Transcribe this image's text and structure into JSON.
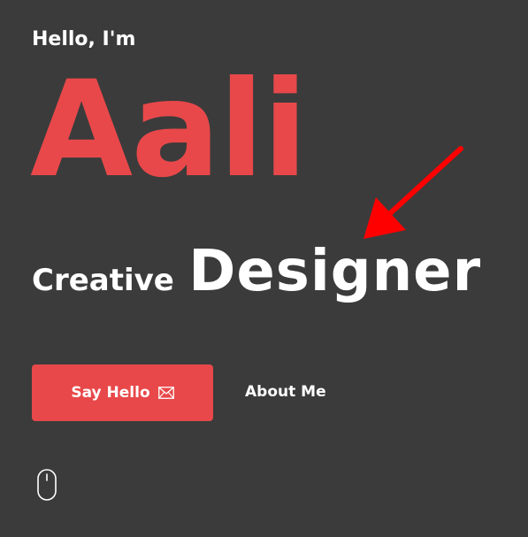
{
  "hero": {
    "greeting": "Hello, I'm",
    "name": "Aali",
    "role_prefix": "Creative",
    "role": "Designer"
  },
  "actions": {
    "primary_label": "Say Hello",
    "primary_icon": "mail-icon",
    "secondary_label": "About Me"
  },
  "scroll_indicator": {
    "icon": "mouse-icon"
  },
  "annotation": {
    "icon": "arrow-icon",
    "color": "#ff0000"
  },
  "colors": {
    "background": "#3b3b3b",
    "accent": "#e8484a",
    "text": "#ffffff"
  }
}
